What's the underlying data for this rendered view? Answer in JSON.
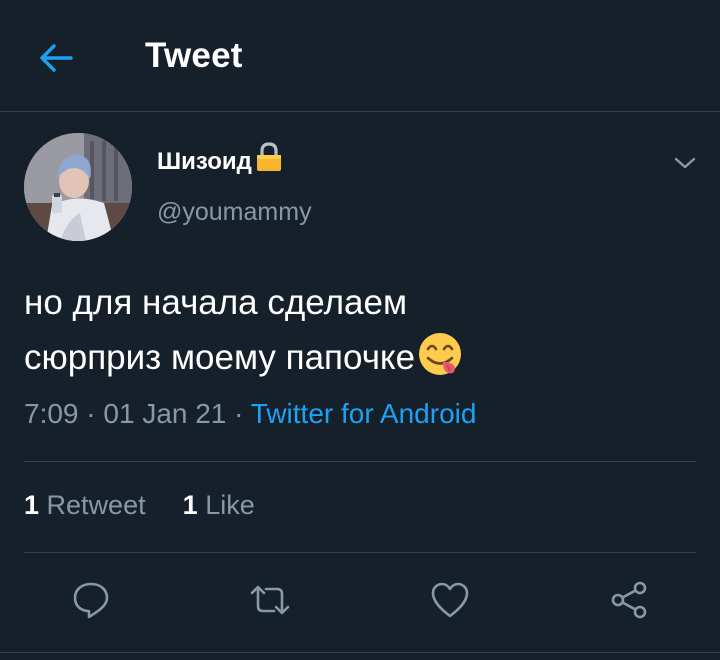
{
  "header": {
    "title": "Tweet",
    "back_icon": "arrow-left-icon"
  },
  "tweet": {
    "author": {
      "display_name": "Шизоид",
      "name_badge": "lock-emoji",
      "handle": "@youmammy"
    },
    "text_lines": [
      "но для начала сделаем",
      "сюрприз моему папочке"
    ],
    "text_emoji": "face-savoring-food-emoji",
    "time": "7:09",
    "date": "01 Jan 21",
    "separator": "·",
    "source": "Twitter for Android",
    "stats": {
      "retweets_count": "1",
      "retweets_label": "Retweet",
      "likes_count": "1",
      "likes_label": "Like"
    }
  },
  "actions": [
    "reply-icon",
    "retweet-icon",
    "like-icon",
    "share-icon"
  ],
  "colors": {
    "background": "#15202b",
    "accent": "#1da1f2",
    "secondary_text": "#8899a6",
    "divider": "#38444d"
  }
}
